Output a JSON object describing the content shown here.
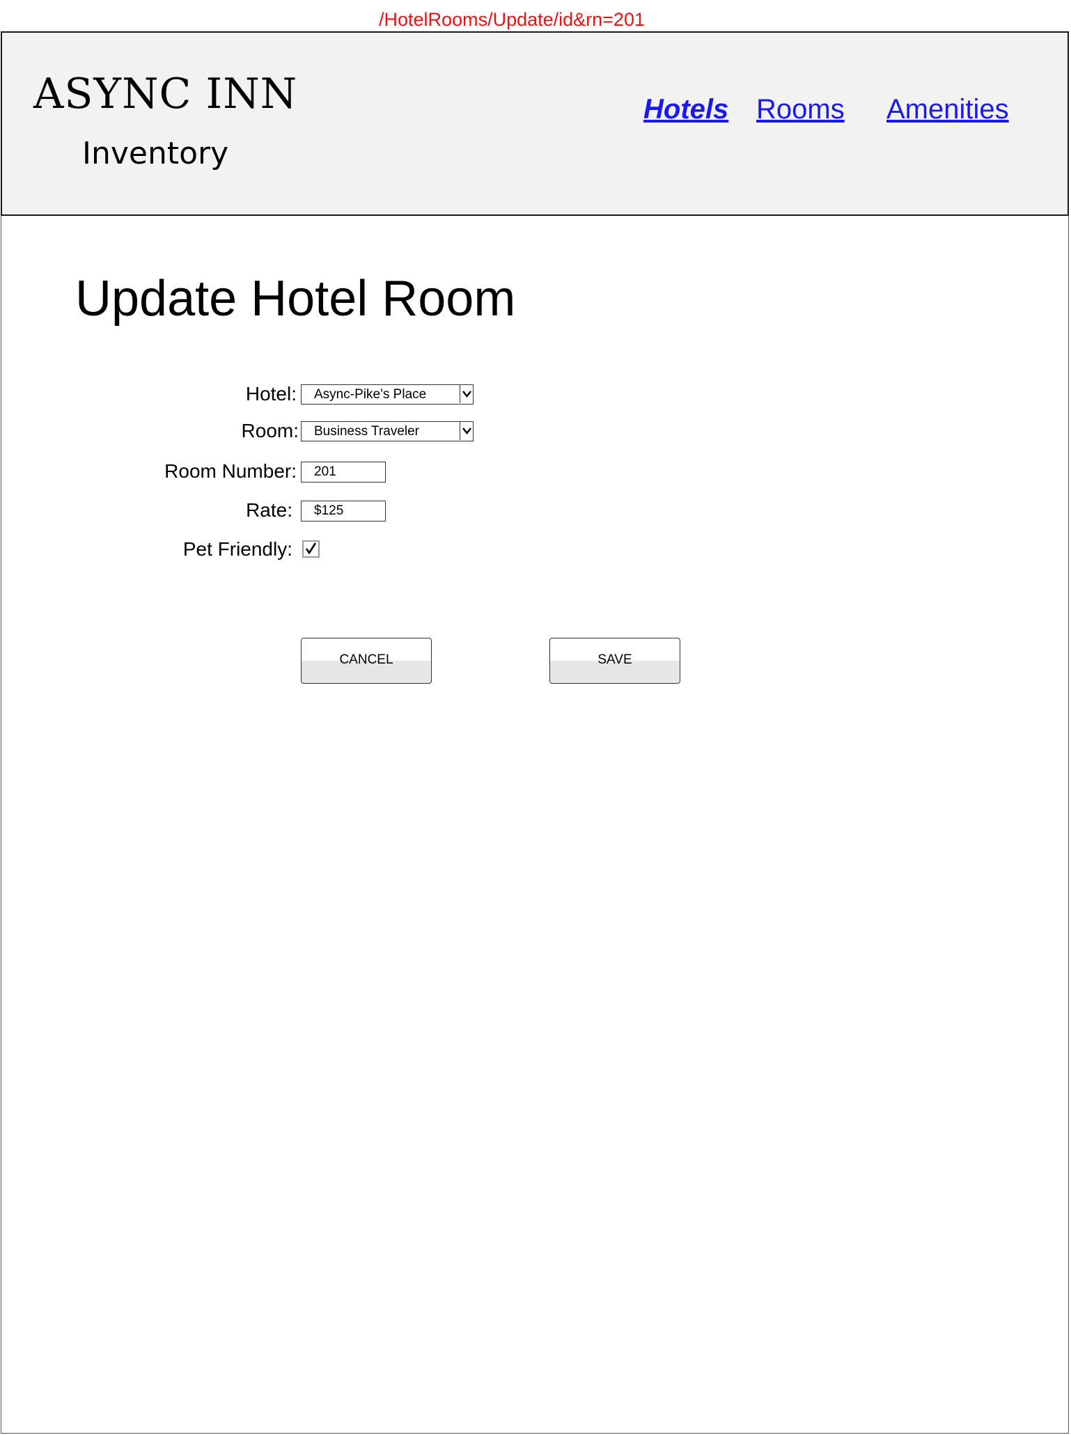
{
  "url_path": "/HotelRooms/Update/id&rn=201",
  "header": {
    "brand": "ASYNC INN",
    "subtitle": "Inventory",
    "nav": [
      {
        "label": "Hotels",
        "active": true
      },
      {
        "label": "Rooms",
        "active": false
      },
      {
        "label": "Amenities",
        "active": false
      }
    ]
  },
  "page": {
    "title": "Update Hotel Room"
  },
  "form": {
    "hotel": {
      "label": "Hotel:",
      "value": "Async-Pike’s Place"
    },
    "room": {
      "label": "Room:",
      "value": "Business Traveler"
    },
    "room_number": {
      "label": "Room Number:",
      "value": "201"
    },
    "rate": {
      "label": "Rate:",
      "value": "$125"
    },
    "pet_friendly": {
      "label": "Pet Friendly:",
      "checked": true
    }
  },
  "actions": {
    "cancel_label": "CANCEL",
    "save_label": "SAVE"
  },
  "colors": {
    "url_text": "#ee1111",
    "header_bg": "#f2f2f2",
    "link": "#1a1aee"
  },
  "icons": {
    "dropdown": "chevron-down-icon",
    "checkbox": "checkmark-icon"
  }
}
